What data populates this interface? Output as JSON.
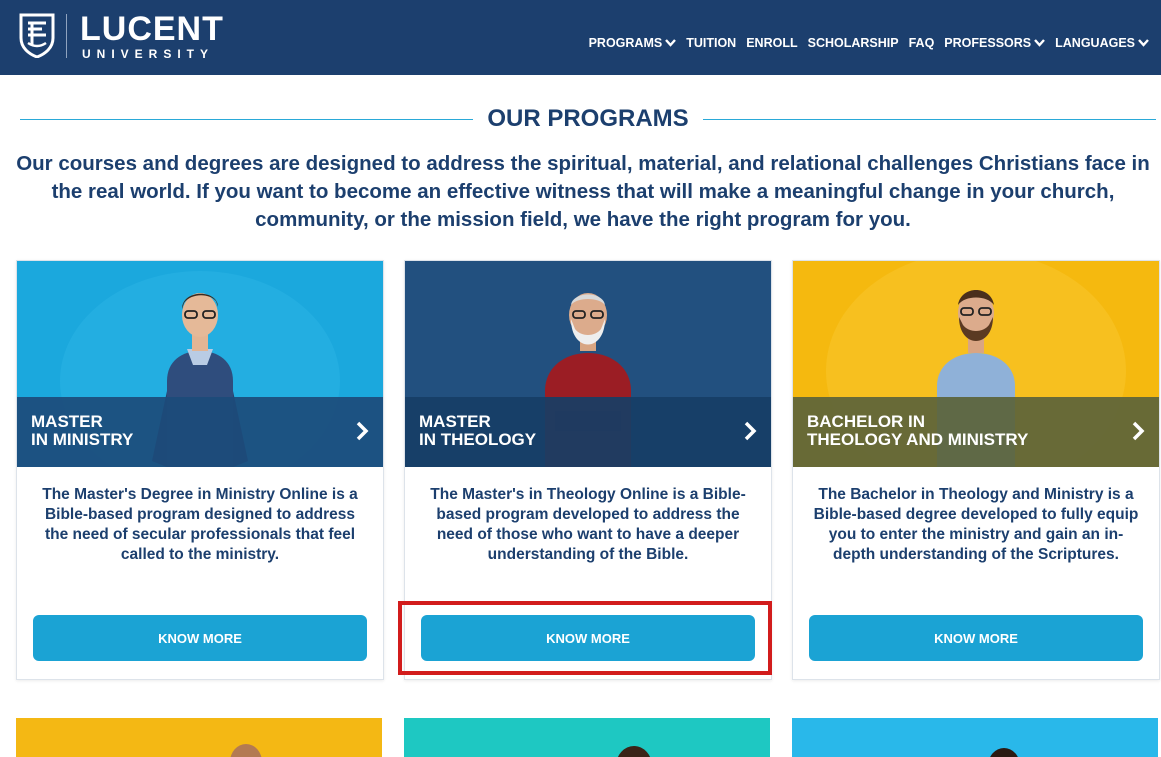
{
  "header": {
    "brand_name": "LUCENT",
    "brand_sub": "UNIVERSITY",
    "nav": [
      {
        "label": "PROGRAMS",
        "dropdown": true
      },
      {
        "label": "TUITION",
        "dropdown": false
      },
      {
        "label": "ENROLL",
        "dropdown": false
      },
      {
        "label": "SCHOLARSHIP",
        "dropdown": false
      },
      {
        "label": "FAQ",
        "dropdown": false
      },
      {
        "label": "PROFESSORS",
        "dropdown": true
      },
      {
        "label": "LANGUAGES",
        "dropdown": true
      }
    ],
    "color": "#1c3f6e"
  },
  "programs_section": {
    "title": "OUR PROGRAMS",
    "intro": "Our courses and degrees are designed to address the spiritual, material, and relational challenges Christians face in the real world. If you want to become an effective witness that will make a meaningful change in your church, community, or the mission field, we have the right program for you.",
    "accent_color": "#2aa9d8",
    "cards": [
      {
        "title_line1": "MASTER",
        "title_line2": "IN MINISTRY",
        "description": "The Master's Degree in Ministry Online is a Bible-based program designed to address the need of secular professionals that feel called to the ministry.",
        "button_label": "KNOW MORE",
        "photo_bg": "#1ba8dd",
        "band_color": "#1c4b7a"
      },
      {
        "title_line1": "MASTER",
        "title_line2": "IN THEOLOGY",
        "description": "The Master's in Theology Online is a Bible-based program developed to address the need of those who want to have a deeper understanding of the Bible.",
        "button_label": "KNOW MORE",
        "photo_bg": "#22507f",
        "band_color": "#173e66",
        "highlighted": true
      },
      {
        "title_line1": "BACHELOR IN",
        "title_line2": "THEOLOGY AND MINISTRY",
        "description": "The Bachelor in Theology and Ministry is a Bible-based degree developed to fully equip you to enter the ministry and gain an in-depth understanding of the Scriptures.",
        "button_label": "KNOW MORE",
        "photo_bg": "#f5b90f",
        "band_color": "#5b6339"
      }
    ]
  },
  "button_color": "#1ba3d4",
  "highlight_color": "#d21c1c"
}
